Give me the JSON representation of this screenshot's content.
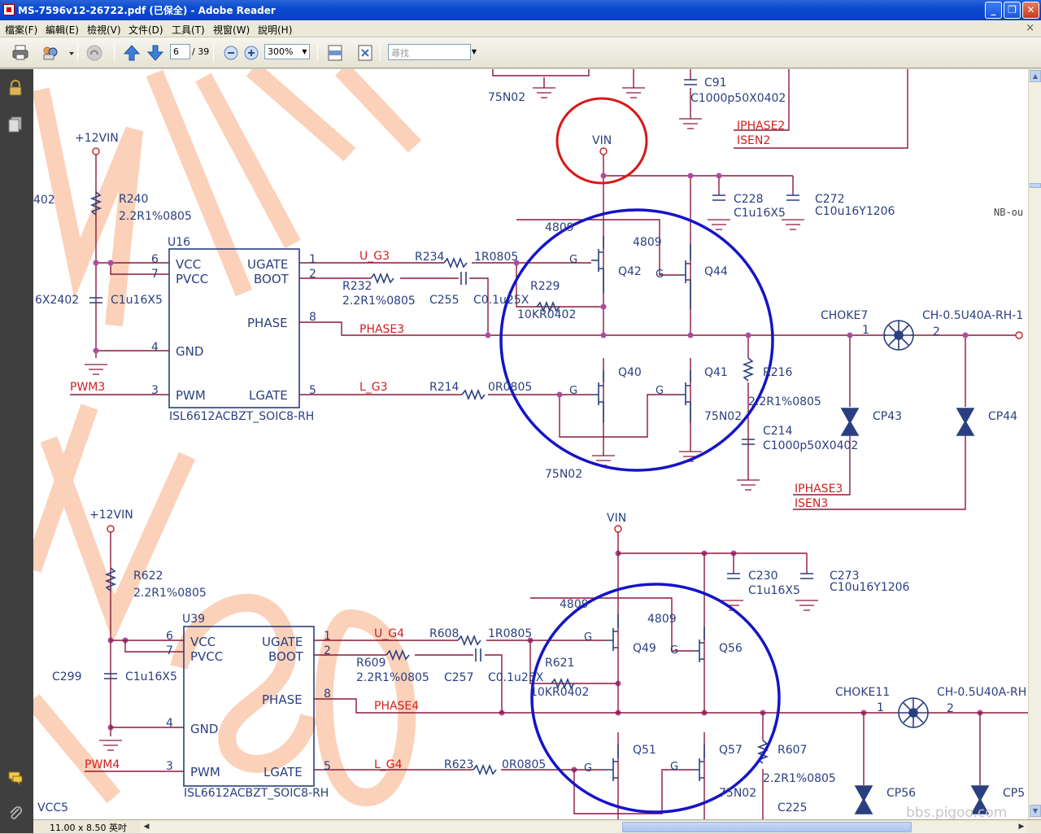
{
  "window": {
    "title": "MS-7596v12-26722.pdf (已保全) - Adobe Reader",
    "min_icon": "minimize-icon",
    "max_icon": "restore-icon",
    "close_icon": "close-icon"
  },
  "menu": {
    "items": [
      {
        "label": "檔案(F)"
      },
      {
        "label": "編輯(E)"
      },
      {
        "label": "檢視(V)"
      },
      {
        "label": "文件(D)"
      },
      {
        "label": "工具(T)"
      },
      {
        "label": "視窗(W)"
      },
      {
        "label": "說明(H)"
      }
    ],
    "close_glyph": "×"
  },
  "toolbar": {
    "current_page": "6",
    "total_pages": "/ 39",
    "zoom": "300%",
    "find_placeholder": "尋找"
  },
  "status": {
    "page_size": "11.00 x 8.50 英吋"
  },
  "watermark": {
    "site": "bbs.pigoo.com"
  },
  "schematic": {
    "top": {
      "labels": [
        "75N02",
        "C91",
        "C1000p50X0402",
        "IPHASE2",
        "ISEN2",
        "VIN",
        "+12VIN",
        "R240",
        "2.2R1%0805",
        "U16",
        "C228",
        "C1u16X5",
        "C272",
        "C10u16Y1206",
        "NB-ou",
        "402",
        "6",
        "7",
        "VCC",
        "PVCC",
        "UGATE",
        "BOOT",
        "1",
        "2",
        "U_G3",
        "R234",
        "1R0805",
        "R232",
        "2.2R1%0805",
        "C255",
        "C0.1u25X",
        "4809",
        "4809",
        "Q42",
        "Q44",
        "R229",
        "10KR0402",
        "6X2402",
        "C1u16X5",
        "PHASE",
        "8",
        "PHASE3",
        "CHOKE7",
        "1",
        "2",
        "CH-0.5U40A-RH-1",
        "4",
        "GND",
        "PWM3",
        "3",
        "PWM",
        "LGATE",
        "5",
        "L_G3",
        "R214",
        "0R0805",
        "Q40",
        "Q41",
        "R216",
        "2.2R1%0805",
        "75N02",
        "CP43",
        "CP44",
        "C214",
        "C1000p50X0402",
        "ISL6612ACBZT_SOIC8-RH",
        "75N02",
        "IPHASE3",
        "ISEN3"
      ]
    },
    "bottom": {
      "labels": [
        "+12VIN",
        "VIN",
        "R622",
        "2.2R1%0805",
        "U39",
        "C230",
        "C1u16X5",
        "C273",
        "C10u16Y1206",
        "4809",
        "4809",
        "6",
        "7",
        "VCC",
        "PVCC",
        "UGATE",
        "BOOT",
        "1",
        "2",
        "U_G4",
        "R608",
        "1R0805",
        "Q49",
        "Q56",
        "C299",
        "C1u16X5",
        "R609",
        "2.2R1%0805",
        "C257",
        "C0.1u25X",
        "R621",
        "10KR0402",
        "PHASE",
        "8",
        "PHASE4",
        "CHOKE11",
        "1",
        "2",
        "CH-0.5U40A-RH",
        "4",
        "GND",
        "Q51",
        "Q57",
        "R607",
        "PWM4",
        "3",
        "PWM",
        "LGATE",
        "5",
        "L_G4",
        "R623",
        "0R0805",
        "2.2R1%0805",
        "75N02",
        "CP56",
        "CP5",
        "ISL6612ACBZT_SOIC8-RH",
        "C225",
        "VCC5"
      ]
    }
  }
}
